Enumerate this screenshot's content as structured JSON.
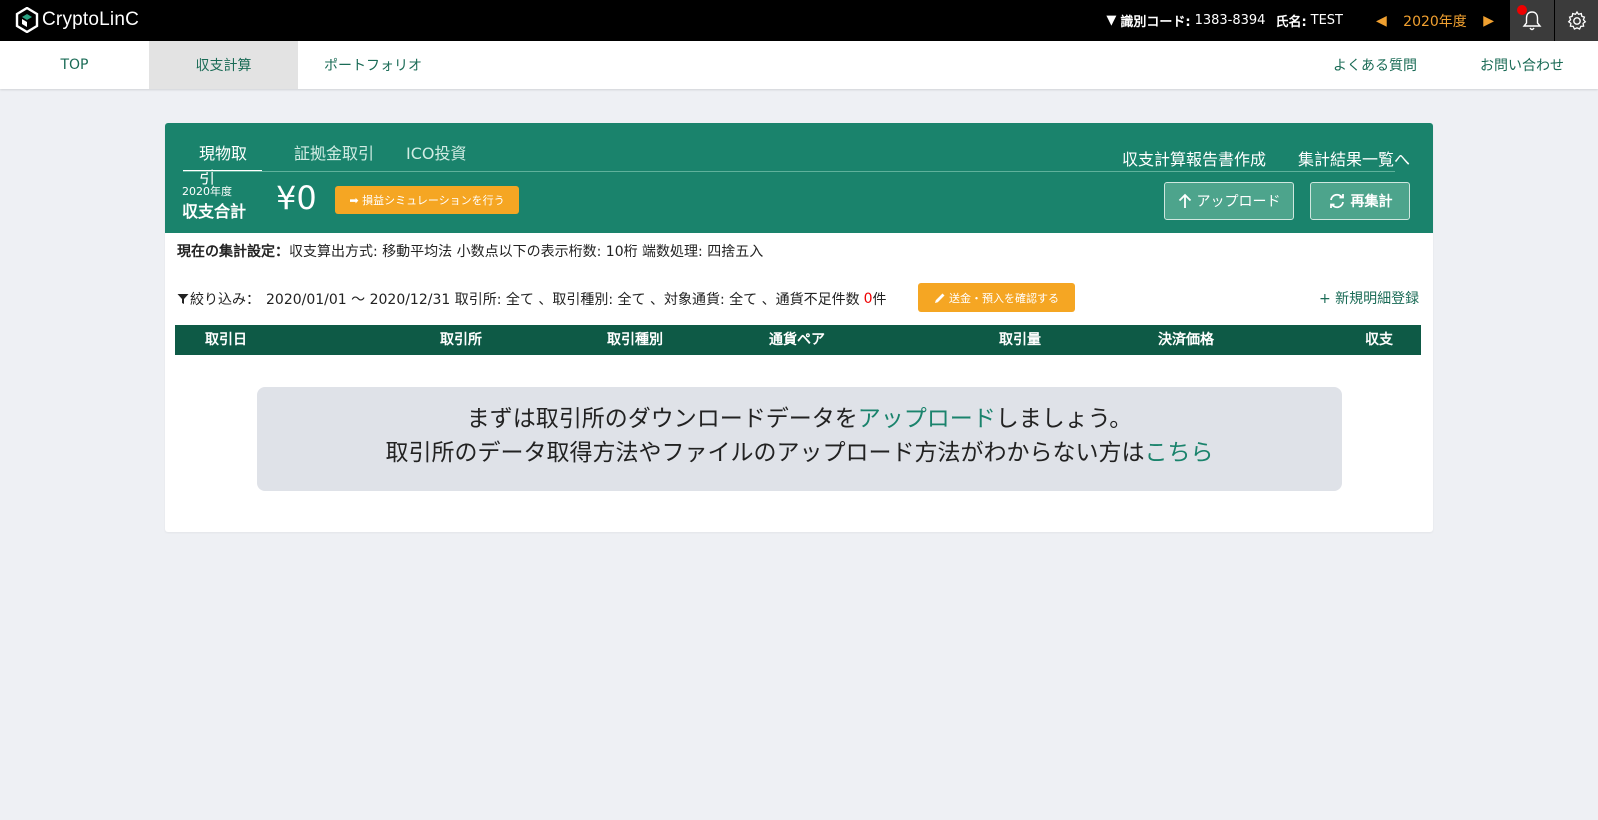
{
  "app": {
    "logo_text": "CryptoLinC"
  },
  "topbar": {
    "id_label": "識別コード:",
    "id_value": "1383-8394",
    "name_label": "氏名:",
    "name_value": "TEST",
    "year": "2020年度",
    "prev_icon": "triangle-left-icon",
    "next_icon": "triangle-right-icon"
  },
  "nav": {
    "items": [
      {
        "label": "TOP"
      },
      {
        "label": "収支計算"
      },
      {
        "label": "ポートフォリオ"
      },
      {
        "label": "よくある質問"
      },
      {
        "label": "お問い合わせ"
      }
    ],
    "active_index": 1
  },
  "card": {
    "tabs": [
      {
        "label": "現物取引"
      },
      {
        "label": "証拠金取引"
      },
      {
        "label": "ICO投資"
      }
    ],
    "report_link": "収支計算報告書作成",
    "results_link": "集計結果一覧へ",
    "fiscal_year": "2020年度",
    "total_label": "収支合計",
    "total_value": "¥0",
    "simulation_button": "➡ 損益シミュレーションを行う",
    "upload_button": "アップロード",
    "recalc_button": "再集計"
  },
  "settings": {
    "label": "現在の集計設定：",
    "text": "収支算出方式: 移動平均法  小数点以下の表示桁数: 10桁  端数処理: 四捨五入"
  },
  "filter": {
    "label": "絞り込み：",
    "text": "2020/01/01 〜 2020/12/31 取引所: 全て 、取引種別: 全て 、対象通貨: 全て 、通貨不足件数",
    "shortage_count": "0",
    "count_unit": "件",
    "confirm_button": "送金・預入を確認する",
    "new_entry_link": "+ 新規明細登録"
  },
  "table": {
    "columns": [
      "取引日",
      "取引所",
      "取引種別",
      "通貨ペア",
      "取引量",
      "決済価格",
      "収支"
    ]
  },
  "notice": {
    "line1_before": "まずは取引所のダウンロードデータを",
    "line1_link": "アップロード",
    "line1_after": "しましょう。",
    "line2_before": "取引所のデータ取得方法やファイルのアップロード方法がわからない方は",
    "line2_link": "こちら"
  },
  "colors": {
    "brand_green": "#1a836c",
    "dark_green": "#0e5a46",
    "accent_orange": "#f5a623",
    "alert_red": "#ee0000"
  }
}
